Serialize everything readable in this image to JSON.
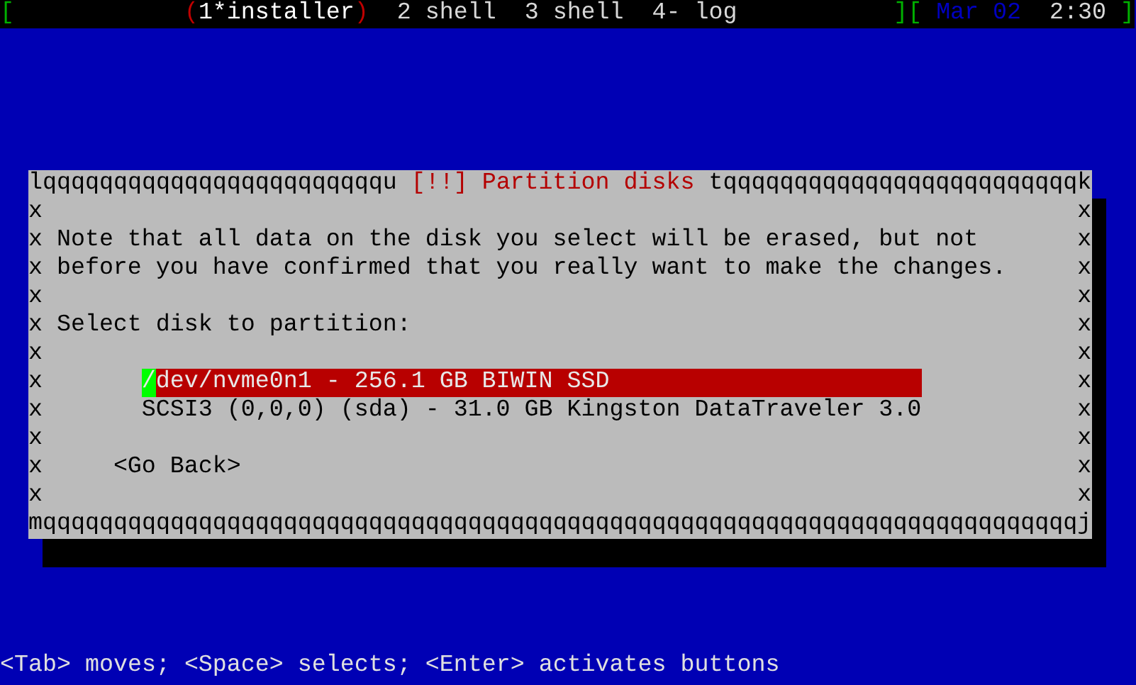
{
  "top_bar": {
    "open_bracket": "[",
    "active_marks": [
      "(",
      ")"
    ],
    "windows": [
      {
        "label": "1*installer",
        "selected": true
      },
      {
        "label": "2 shell",
        "selected": false
      },
      {
        "label": "3 shell",
        "selected": false
      },
      {
        "label": "4- log",
        "selected": false
      }
    ],
    "close_bracket": "]",
    "clock_open_bracket": "[",
    "date": "Mar 02",
    "time": "2:30",
    "clock_close_bracket": "]"
  },
  "dialog": {
    "border_top_left": "lqqqqqqqqqqqqqqqqqqqqqqqqu",
    "title": "[!!] Partition disks",
    "border_top_right": "tqqqqqqqqqqqqqqqqqqqqqqqqqk",
    "side_marks": [
      {
        "left": "x",
        "right": "x"
      },
      {
        "left": "x",
        "right": "x"
      },
      {
        "left": "x",
        "right": "x"
      },
      {
        "left": "x",
        "right": "x"
      },
      {
        "left": "x",
        "right": "x"
      },
      {
        "left": "x",
        "right": "x"
      },
      {
        "left": "x",
        "right": "x"
      },
      {
        "left": "x",
        "right": "x"
      },
      {
        "left": "x",
        "right": "x"
      },
      {
        "left": "x",
        "right": "x"
      },
      {
        "left": "x",
        "right": "x"
      }
    ],
    "message": [
      "Note that all data on the disk you select will be erased, but not",
      "before you have confirmed that you really want to make the changes."
    ],
    "prompt": "Select disk to partition:",
    "disks": [
      {
        "label": "/dev/nvme0n1 - 256.1 GB BIWIN SSD",
        "selected": true
      },
      {
        "label": "SCSI3 (0,0,0) (sda) - 31.0 GB Kingston DataTraveler 3.0",
        "selected": false
      }
    ],
    "go_back": "<Go Back>",
    "border_bottom": "mqqqqqqqqqqqqqqqqqqqqqqqqqqqqqqqqqqqqqqqqqqqqqqqqqqqqqqqqqqqqqqqqqqqqqqqqqj"
  },
  "status_line": "<Tab> moves; <Space> selects; <Enter> activates buttons"
}
